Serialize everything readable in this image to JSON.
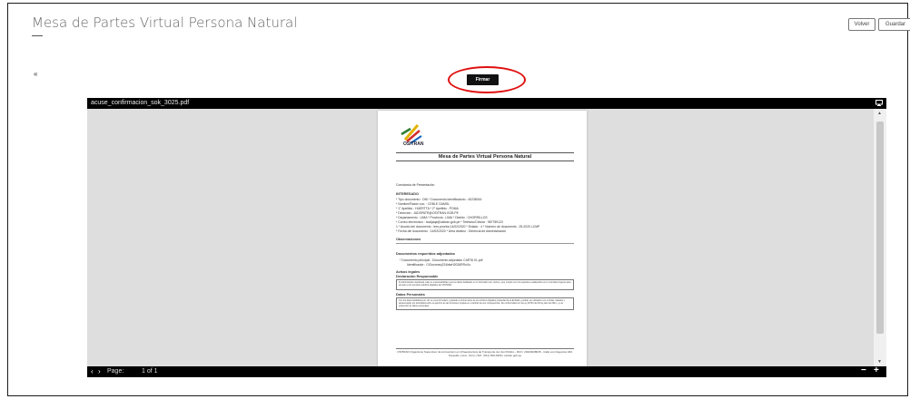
{
  "header": {
    "title": "Mesa de Partes Virtual Persona Natural",
    "volver_label": "Volver",
    "guardar_label": "Guardar"
  },
  "back_icon": "«",
  "firmar_label": "Firmar",
  "highlight_color": "#e01010",
  "viewer": {
    "filename": "acuse_confirmacion_sok_3025.pdf",
    "page_label": "Page:",
    "page_count": "1 of 1",
    "prev_icon": "‹",
    "next_icon": "›",
    "zoom_out_icon": "−",
    "zoom_in_icon": "+"
  },
  "document": {
    "logo_text": "OSITRAN",
    "title": "Mesa de Partes Virtual Persona Natural",
    "section_constancia": "Constancia de Presentación",
    "section_interesado": "INTERESADO",
    "line1": "* Tipo documento : DNI  * Documento identificatorio : 40238016",
    "line2": "* Nombre/Razón soc. : CEBLE GAMSL",
    "line3": "* 1° Apellido : HUERTTA   * 2° Apellido : POMA",
    "line4": "* Dirección : JADSPATR@OSITRAN.GOB.PE",
    "line5": "* Departamento : LIMA  * Provincia : LIMA  * Distrito : CHORRILLOS",
    "line6": "* Correo electrónico : hcaljaqa@ositran.gob.pe  * Teléfono/Celular : 987789123",
    "line7": "1  * Asunto del documento : tres.prueba 14/02/2020  * Estado : 4  * Número de documento : 25-2020 LCMP",
    "line8": "* Fecha del documento : 14/02/2020  * Área destino : Gerencia de Administración",
    "observaciones": "Observaciones",
    "documentos": "Documentos requeridos adjuntados",
    "doc_line1": "* Documento principal :  Documento adjuntado CARTA 01.pdf",
    "doc_line2": "Identificador : CiOnzomrq224ldwH2026RRoXo",
    "avisos": "Avisos legales",
    "declaracion": "Declaración Responsable",
    "declaracion_text": "Al administrado manifiesta, bajo su responsabilidad, que los datos facilitados en el formulario son ciertos y que cumple con los requisitos establecidos en la normativa vigente para acceder a los servicios públicos digitales del OSITRAN.",
    "datos": "Datos Personales",
    "datos_text": "Con los datos facilitados por Ud. se crea formulario y pasarán a formar parte de los archivos digitales propiedad de la Entidad y podrán ser utilizados con el titular, tratados y almacenados por la Entidad sobre el ejercicio de las funciones propias en el ámbito de sus competencias. De conformidad con la Ley 29733 del 03 de julio del 2011, y a la protección de datos personales.",
    "footer": "OSITRAN Organismo Supervisor de la Inversión en Infraestructura de Transporte de Uso Público - RUC: 20420248645 - Calle Los Negocios 182, Surquillo, Lima - Perú | Telf.: (511) 500-9330 | ositran.gob.pe"
  }
}
